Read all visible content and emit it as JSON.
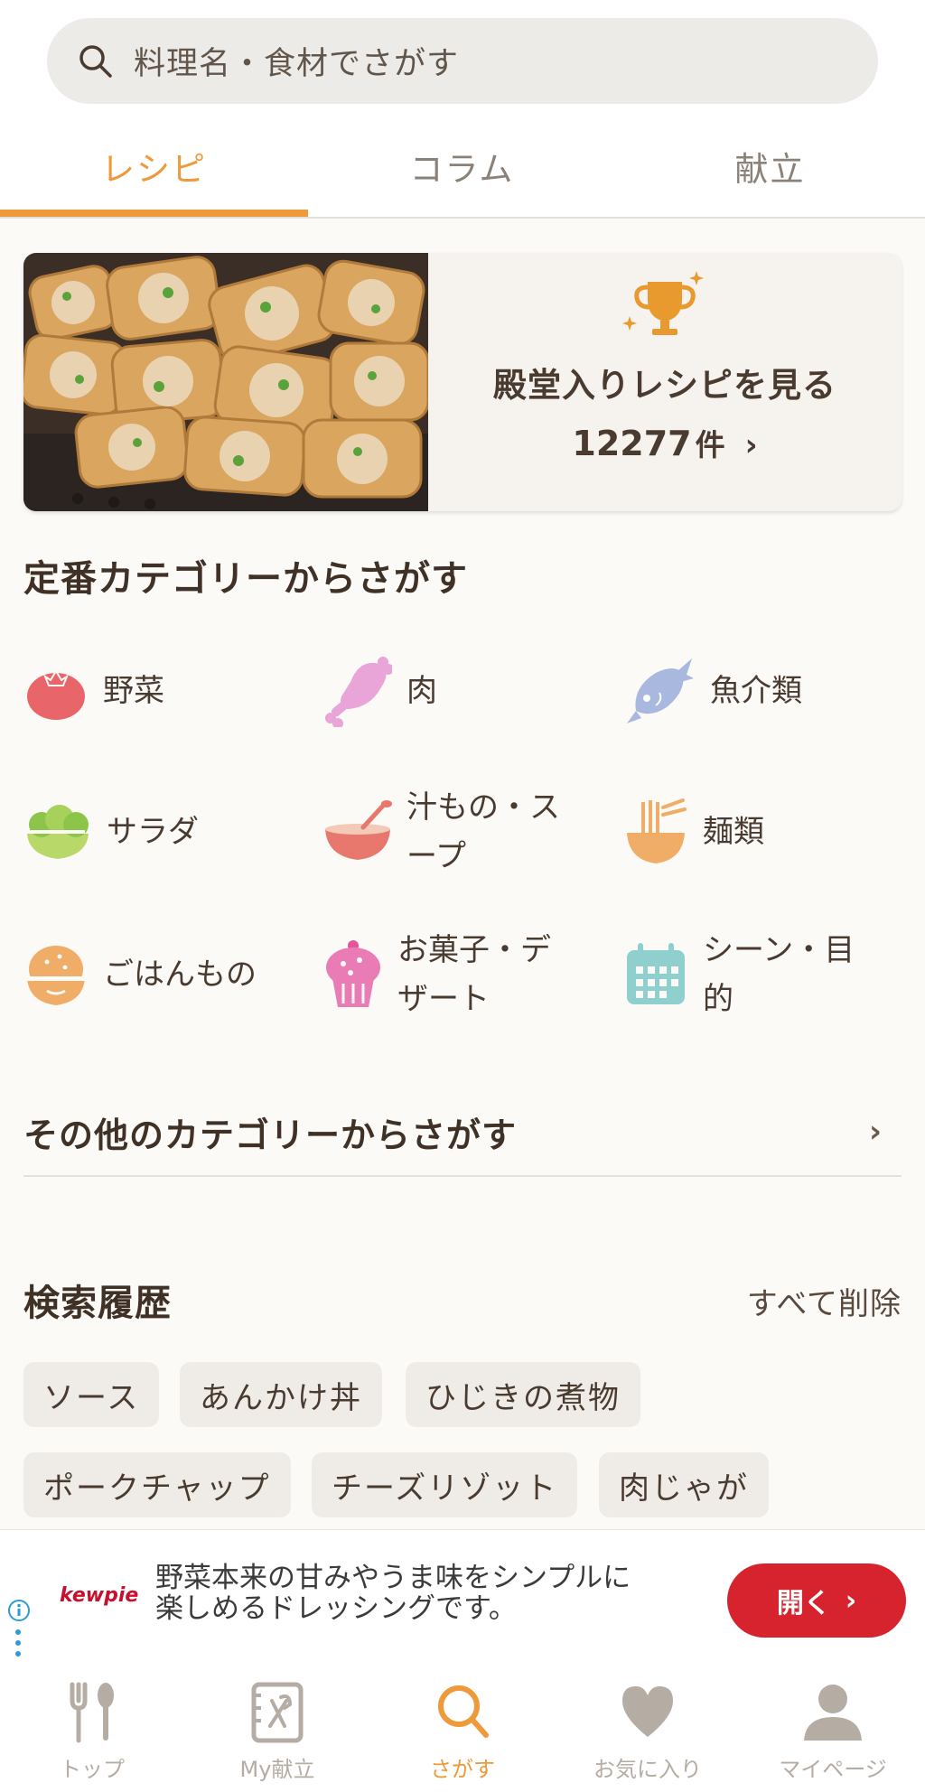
{
  "search": {
    "placeholder": "料理名・食材でさがす",
    "icon": "search-icon"
  },
  "tabs": [
    {
      "label": "レシピ",
      "active": true
    },
    {
      "label": "コラム",
      "active": false
    },
    {
      "label": "献立",
      "active": false
    }
  ],
  "hall_of_fame": {
    "title": "殿堂入りレシピを見る",
    "count": "12277",
    "unit": "件",
    "icon": "trophy-icon",
    "image": "spring-rolls-photo"
  },
  "categories": {
    "title": "定番カテゴリーからさがす",
    "items": [
      {
        "label": "野菜",
        "icon": "tomato-icon"
      },
      {
        "label": "肉",
        "icon": "meat-icon"
      },
      {
        "label": "魚介類",
        "icon": "fish-icon"
      },
      {
        "label": "サラダ",
        "icon": "salad-icon"
      },
      {
        "label": "汁もの・スープ",
        "icon": "soup-icon"
      },
      {
        "label": "麺類",
        "icon": "noodles-icon"
      },
      {
        "label": "ごはんもの",
        "icon": "rice-bowl-icon"
      },
      {
        "label": "お菓子・デザート",
        "icon": "cupcake-icon"
      },
      {
        "label": "シーン・目的",
        "icon": "calendar-icon"
      }
    ],
    "other_label": "その他のカテゴリーからさがす"
  },
  "history": {
    "title": "検索履歴",
    "clear_label": "すべて削除",
    "items": [
      "ソース",
      "あんかけ丼",
      "ひじきの煮物",
      "ポークチャップ",
      "チーズリゾット",
      "肉じゃが"
    ]
  },
  "ad": {
    "brand": "kewpie",
    "text_line1": "野菜本来の甘みやうま味をシンプルに",
    "text_line2": "楽しめるドレッシングです。",
    "button_label": "開く"
  },
  "bottom_nav": [
    {
      "label": "トップ",
      "icon": "fork-knife-icon",
      "active": false
    },
    {
      "label": "My献立",
      "icon": "menu-book-icon",
      "active": false
    },
    {
      "label": "さがす",
      "icon": "search-icon",
      "active": true
    },
    {
      "label": "お気に入り",
      "icon": "heart-icon",
      "active": false
    },
    {
      "label": "マイページ",
      "icon": "user-icon",
      "active": false
    }
  ],
  "colors": {
    "accent": "#ee9a3a",
    "text": "#4a3b30",
    "background": "#fcfaf7",
    "ad_button": "#d6232e"
  }
}
